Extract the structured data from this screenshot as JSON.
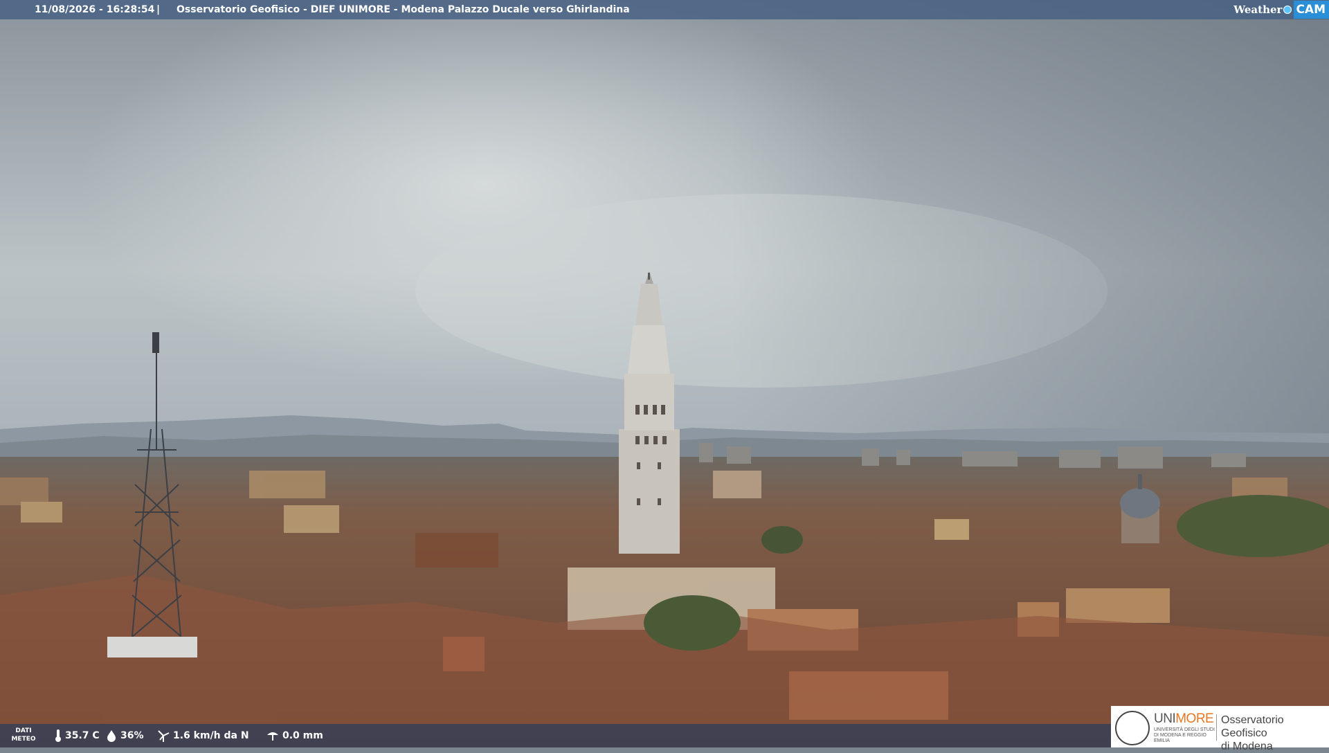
{
  "header": {
    "timestamp": "11/08/2026 - 16:28:54",
    "separator": "|",
    "title": "Osservatorio Geofisico - DIEF UNIMORE - Modena Palazzo Ducale verso Ghirlandina"
  },
  "weathercam_logo": {
    "word": "Weather",
    "cam": "CAM"
  },
  "footer": {
    "dati_meteo": "DATI\nMETEO",
    "temperature": "35.7 C",
    "humidity": "36%",
    "wind": "1.6 km/h da N",
    "rain": "0.0 mm"
  },
  "partner_logo": {
    "brand_prefix": "UNI",
    "brand_suffix": "MORE",
    "brand_sub": "UNIVERSITÀ DEGLI STUDI DI MODENA E REGGIO EMILIA",
    "observatory_line1": "Osservatorio Geofisico",
    "observatory_line2": "di Modena"
  },
  "colors": {
    "sky_top": "#8a949c",
    "sky_mid": "#b8c0c5",
    "roofs": "#8a5a42",
    "header_bg": "#46607f",
    "unimore_orange": "#e87722"
  }
}
